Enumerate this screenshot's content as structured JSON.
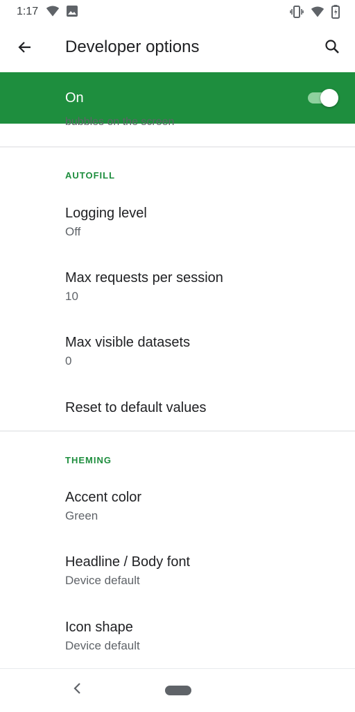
{
  "status_bar": {
    "time": "1:17",
    "left_icons": [
      "wifi-icon",
      "image-icon"
    ],
    "right_icons": [
      "vibrate-icon",
      "wifi-icon",
      "battery-icon"
    ]
  },
  "app_bar": {
    "title": "Developer options",
    "back_icon": "arrow-back-icon",
    "search_icon": "search-icon"
  },
  "master_switch": {
    "label": "On",
    "checked": true,
    "color": "#1e8e3e"
  },
  "clipped_text": "bubbles on the screen",
  "sections": [
    {
      "header": "AUTOFILL",
      "items": [
        {
          "title": "Logging level",
          "summary": "Off"
        },
        {
          "title": "Max requests per session",
          "summary": "10"
        },
        {
          "title": "Max visible datasets",
          "summary": "0"
        },
        {
          "title": "Reset to default values",
          "summary": ""
        }
      ]
    },
    {
      "header": "THEMING",
      "items": [
        {
          "title": "Accent color",
          "summary": "Green"
        },
        {
          "title": "Headline / Body font",
          "summary": "Device default"
        },
        {
          "title": "Icon shape",
          "summary": "Device default"
        }
      ]
    }
  ],
  "nav_bar": {
    "back_icon": "nav-back-icon",
    "home_icon": "home-pill-icon"
  }
}
